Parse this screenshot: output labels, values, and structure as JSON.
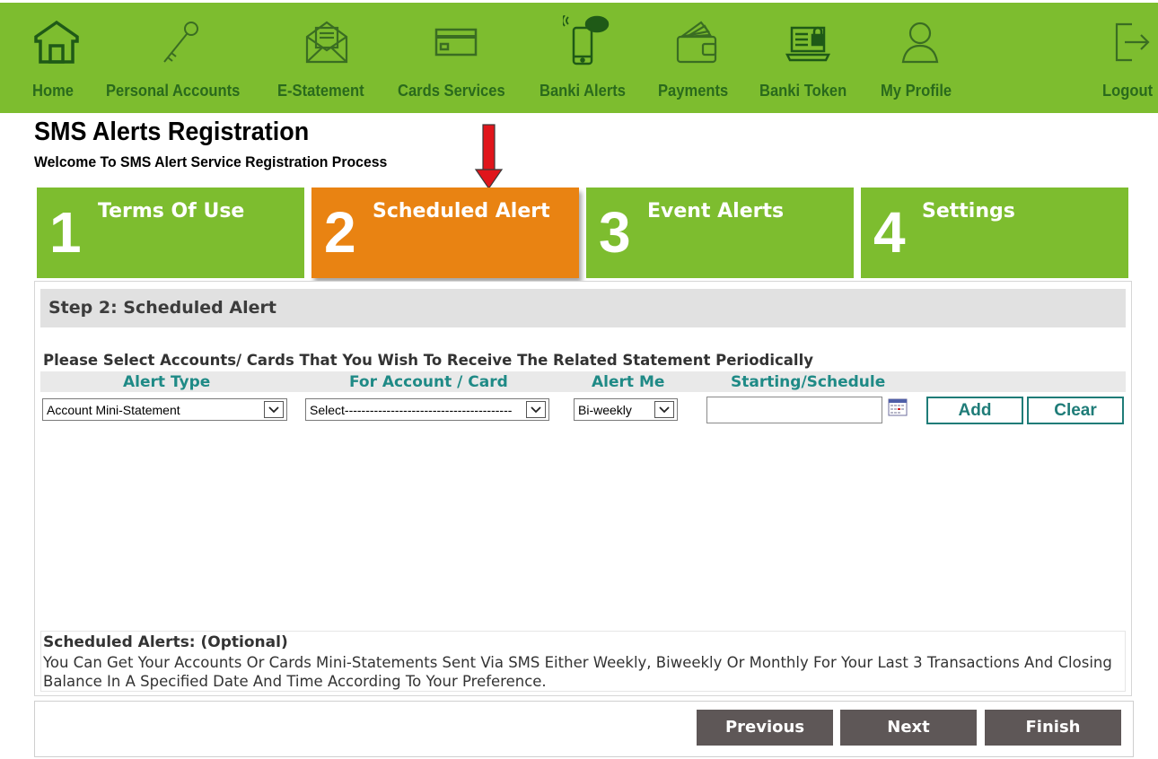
{
  "nav": {
    "items": [
      {
        "label": "Home",
        "icon": "home-icon"
      },
      {
        "label": "Personal Accounts",
        "icon": "key-icon"
      },
      {
        "label": "E-Statement",
        "icon": "envelope-icon"
      },
      {
        "label": "Cards Services",
        "icon": "card-icon"
      },
      {
        "label": "Banki Alerts",
        "icon": "phone-sms-icon"
      },
      {
        "label": "Payments",
        "icon": "wallet-icon"
      },
      {
        "label": "Banki Token",
        "icon": "laptop-lock-icon"
      },
      {
        "label": "My Profile",
        "icon": "user-icon"
      },
      {
        "label": "Logout",
        "icon": "logout-icon"
      }
    ]
  },
  "page": {
    "title": "SMS Alerts Registration",
    "subtitle": "Welcome To SMS Alert Service Registration Process"
  },
  "steps": [
    {
      "number": "1",
      "label": "Terms Of Use",
      "active": false
    },
    {
      "number": "2",
      "label": "Scheduled Alert",
      "active": true
    },
    {
      "number": "3",
      "label": "Event Alerts",
      "active": false
    },
    {
      "number": "4",
      "label": "Settings",
      "active": false
    }
  ],
  "main": {
    "step_title": "Step 2: Scheduled Alert",
    "instruction": "Please Select Accounts/ Cards That You Wish To Receive The Related Statement Periodically",
    "columns": {
      "alert_type": "Alert Type",
      "account": "For Account / Card",
      "alert_me": "Alert Me",
      "starting": "Starting/Schedule"
    },
    "form": {
      "alert_type_value": "Account Mini-Statement",
      "account_value": "Select----------------------------------------",
      "alert_me_value": "Bi-weekly",
      "starting_value": ""
    },
    "buttons": {
      "add": "Add",
      "clear": "Clear"
    },
    "note": {
      "title": "Scheduled Alerts: (Optional)",
      "text": "You Can Get Your Accounts Or Cards Mini-Statements Sent Via SMS Either Weekly, Biweekly Or Monthly For Your Last 3 Transactions And Closing Balance In A Specified Date And Time According To Your Preference."
    }
  },
  "footer": {
    "previous": "Previous",
    "next": "Next",
    "finish": "Finish"
  },
  "colors": {
    "nav_green": "#7dbd2f",
    "nav_label": "#2a6a1c",
    "active_step": "#e98312",
    "teal": "#1f8a86",
    "footer_button": "#5e5757",
    "arrow_red": "#e0151b"
  }
}
